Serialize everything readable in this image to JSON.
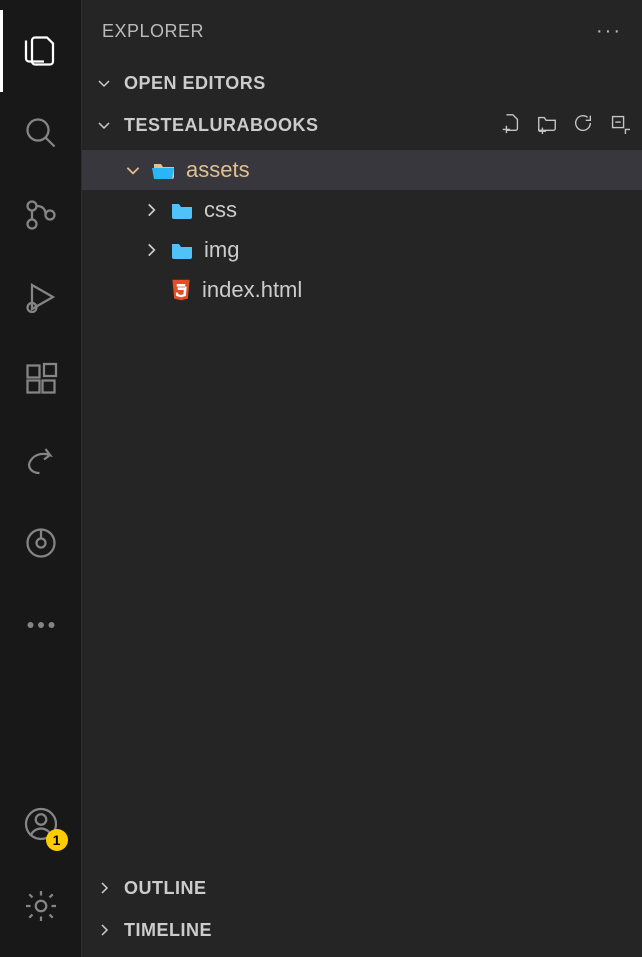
{
  "panel": {
    "title": "EXPLORER"
  },
  "openEditors": {
    "label": "OPEN EDITORS"
  },
  "workspace": {
    "name": "TESTEALURABOOKS"
  },
  "tree": {
    "assets": {
      "name": "assets",
      "expanded": true,
      "selected": true
    },
    "css": {
      "name": "css",
      "expanded": false
    },
    "img": {
      "name": "img",
      "expanded": false
    },
    "index": {
      "name": "index.html"
    }
  },
  "outline": {
    "label": "OUTLINE"
  },
  "timeline": {
    "label": "TIMELINE"
  },
  "account": {
    "badge": "1"
  },
  "icons": {
    "explorer": "files-icon",
    "search": "search-icon",
    "scm": "source-control-icon",
    "debug": "run-debug-icon",
    "extensions": "extensions-icon",
    "share": "share-icon",
    "gitlens": "gitlens-icon",
    "account": "account-icon",
    "settings": "gear-icon"
  }
}
